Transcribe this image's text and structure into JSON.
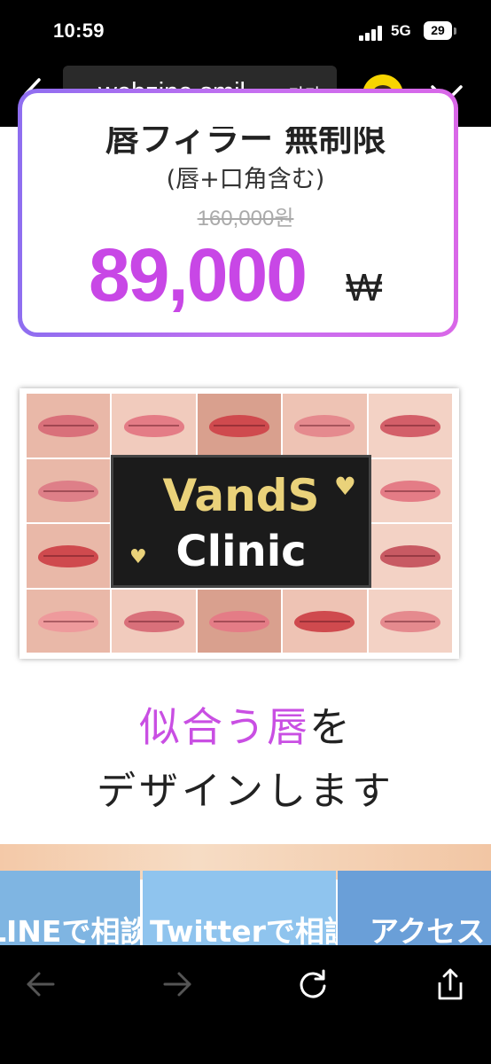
{
  "status": {
    "time": "10:59",
    "network": "5G",
    "battery": "29"
  },
  "browser": {
    "url": "webzine.smil",
    "font_size_label": "가가",
    "icons": [
      "back-icon",
      "kakao-talk-icon",
      "chevron-down-icon",
      "arrow-left-icon",
      "arrow-right-icon",
      "reload-icon",
      "share-icon"
    ]
  },
  "card": {
    "heading": "唇フィラー 無制限",
    "subtitle": "(唇+口角含む)",
    "original_price": "160,000원",
    "sale_price": "89,000",
    "currency": "₩"
  },
  "banner": {
    "logo_line1": "VandS",
    "logo_line2": "Clinic"
  },
  "tagline": {
    "highlight": "似合う唇",
    "rest": "を",
    "line2": "デザインします"
  },
  "cta": {
    "line": "LINEで相談",
    "twitter": "Twitterで相談",
    "access": "アクセス"
  },
  "colors": {
    "accent": "#c847e6",
    "card_border_start": "#8e6ef0",
    "card_border_end": "#d967e8",
    "logo_gold": "#ead27a",
    "cta_line": "#7fb5e2",
    "cta_twitter": "#8fc4ee",
    "cta_access": "#6a9fd8"
  }
}
